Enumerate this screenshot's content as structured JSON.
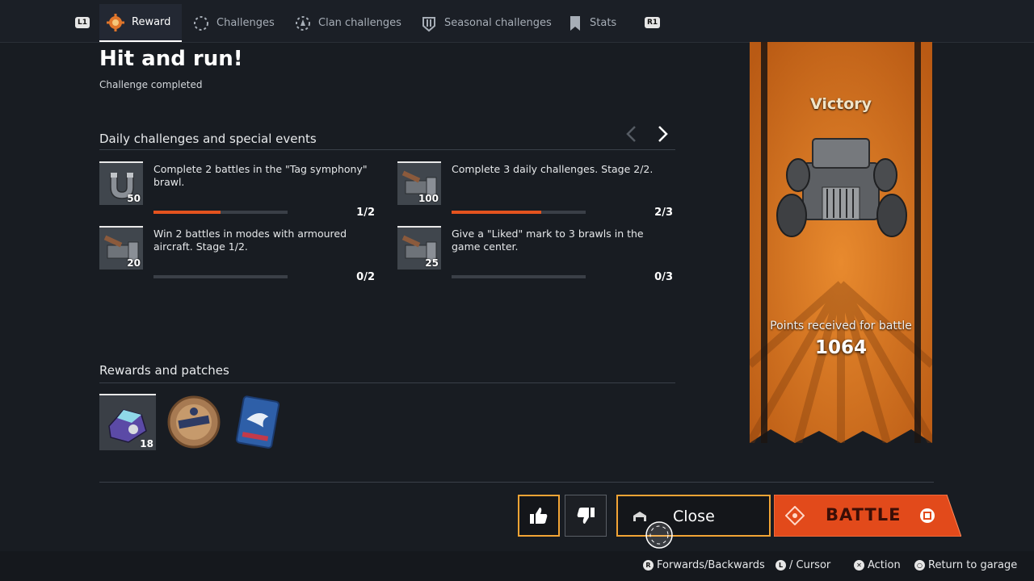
{
  "nav": {
    "left_shoulder": "L1",
    "right_shoulder": "R1",
    "tabs": [
      {
        "label": "Reward",
        "icon": "reward-gear-icon",
        "active": true
      },
      {
        "label": "Challenges",
        "icon": "challenges-icon",
        "active": false
      },
      {
        "label": "Clan challenges",
        "icon": "clan-challenges-icon",
        "active": false
      },
      {
        "label": "Seasonal challenges",
        "icon": "seasonal-challenges-icon",
        "active": false
      },
      {
        "label": "Stats",
        "icon": "stats-icon",
        "active": false
      }
    ]
  },
  "header": {
    "title": "Hit and run!",
    "subtitle": "Challenge completed"
  },
  "daily": {
    "title": "Daily challenges and special events",
    "challenges": [
      {
        "description": "Complete 2 battles in the \"Tag symphony\" brawl.",
        "reward_count": "50",
        "progress_text": "1/2",
        "progress": 0.5
      },
      {
        "description": "Complete 3 daily challenges. Stage 2/2.",
        "reward_count": "100",
        "progress_text": "2/3",
        "progress": 0.667
      },
      {
        "description": "Win 2 battles in modes with armoured aircraft. Stage 1/2.",
        "reward_count": "20",
        "progress_text": "0/2",
        "progress": 0
      },
      {
        "description": "Give a \"Liked\" mark to 3 brawls in the game center.",
        "reward_count": "25",
        "progress_text": "0/3",
        "progress": 0
      }
    ]
  },
  "rewards": {
    "title": "Rewards and patches",
    "items": [
      {
        "name": "parts-container",
        "count": "18"
      },
      {
        "name": "mechanic-patch",
        "count": ""
      },
      {
        "name": "dove-sticker",
        "count": ""
      }
    ]
  },
  "banner": {
    "title": "Victory",
    "points_label": "Points received for battle",
    "points": "1064"
  },
  "actions": {
    "close_label": "Close",
    "battle_label": "BATTLE"
  },
  "hints": [
    {
      "glyph": "R",
      "label": "Forwards/Backwards"
    },
    {
      "glyph": "L",
      "label": "/ Cursor"
    },
    {
      "glyph": "✕",
      "label": "Action"
    },
    {
      "glyph": "○",
      "label": "Return to garage"
    }
  ],
  "colors": {
    "accent_orange": "#e4531e",
    "highlight_border": "#f2a435",
    "banner_orange": "#d7711f"
  }
}
